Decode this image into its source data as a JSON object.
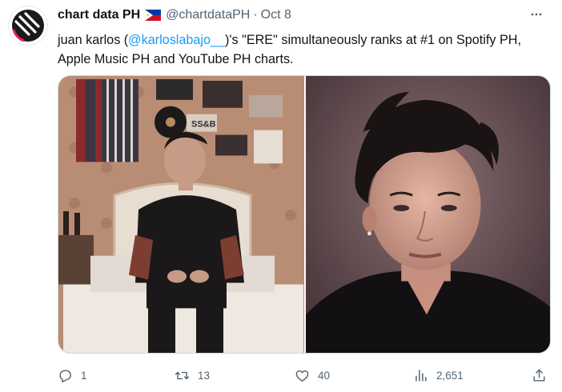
{
  "tweet": {
    "author_name": "chart data PH",
    "flag": "philippines-flag",
    "handle": "@chartdataPH",
    "separator": "·",
    "date": "Oct 8",
    "text_before": "juan karlos (",
    "mention": "@karloslabajo__",
    "text_after": ")'s \"ERE\" simultaneously ranks at #1 on Spotify PH, Apple Music PH and YouTube PH charts."
  },
  "media": {
    "left_poster_label": "SS&B"
  },
  "actions": {
    "replies": "1",
    "reposts": "13",
    "likes": "40",
    "views": "2,651"
  },
  "colors": {
    "text": "#0f1419",
    "muted": "#536471",
    "link": "#1d9bf0",
    "border": "#cfd9de"
  }
}
